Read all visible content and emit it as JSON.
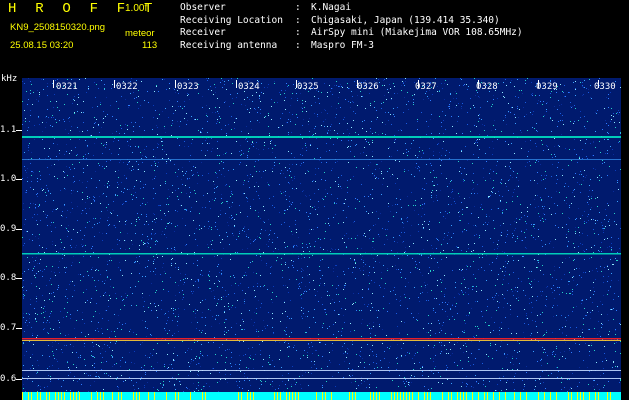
{
  "header": {
    "title": "H R O F F T",
    "version": "1.00f",
    "filename": "KN9_2508150320.png",
    "mode": "meteor",
    "datetime": "25.08.15 03:20",
    "count": "113"
  },
  "info": [
    {
      "key": "Observer",
      "value": "K.Nagai"
    },
    {
      "key": "Receiving Location",
      "value": "Chigasaki, Japan (139.414 35.340)"
    },
    {
      "key": "Receiver",
      "value": "AirSpy mini (Miakejima VOR 108.65MHz)"
    },
    {
      "key": "Receiving antenna",
      "value": "Maspro FM-3"
    }
  ],
  "axes": {
    "y_unit": "kHz",
    "y_ticks": [
      "1.1",
      "1.0",
      "0.9",
      "0.8",
      "0.7",
      "0.6"
    ],
    "x_ticks": [
      "0321",
      "0322",
      "0323",
      "0324",
      "0325",
      "0326",
      "0327",
      "0328",
      "0329",
      "0330"
    ]
  },
  "colors": {
    "background_noise": "#001a6e",
    "header_accent": "#ffff00",
    "carrier_line": "#00e0c0",
    "strong_line": "#ff2020",
    "bottom_strip": "#00ffff"
  }
}
